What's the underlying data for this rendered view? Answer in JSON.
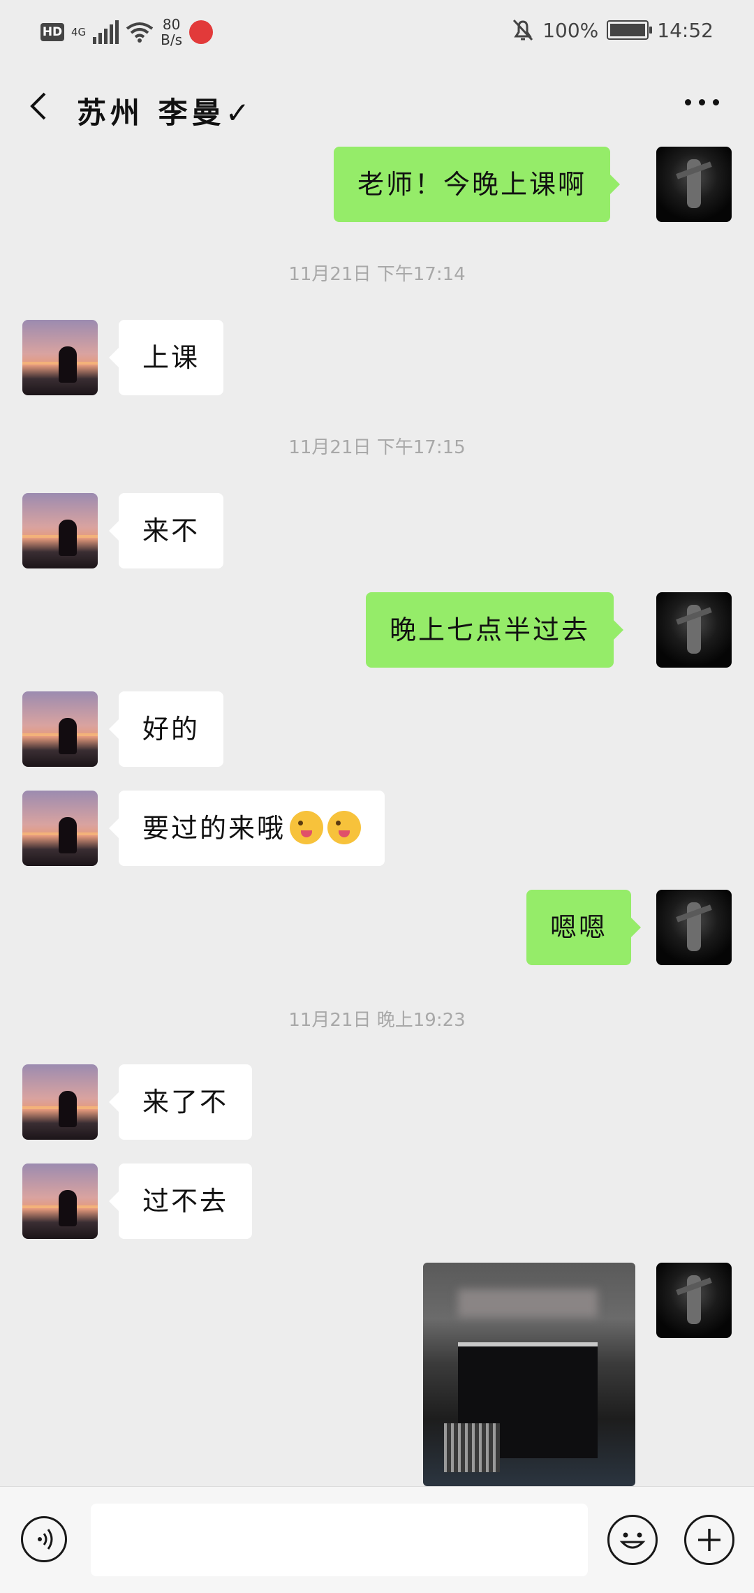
{
  "status_bar": {
    "hd": "HD",
    "network": "4G",
    "speed_value": "80",
    "speed_unit": "B/s",
    "battery": "100%",
    "time": "14:52"
  },
  "header": {
    "title": "苏州 李曼✓"
  },
  "messages": [
    {
      "type": "out",
      "text": "老师！今晚上课啊"
    },
    {
      "type": "time",
      "text": "11月21日 下午17:14"
    },
    {
      "type": "in",
      "text": "上课"
    },
    {
      "type": "time",
      "text": "11月21日 下午17:15"
    },
    {
      "type": "in",
      "text": "来不"
    },
    {
      "type": "out",
      "text": "晚上七点半过去"
    },
    {
      "type": "in",
      "text": "好的"
    },
    {
      "type": "in",
      "text": "要过的来哦"
    },
    {
      "type": "out",
      "text": "嗯嗯"
    },
    {
      "type": "time",
      "text": "11月21日 晚上19:23"
    },
    {
      "type": "in",
      "text": "来了不"
    },
    {
      "type": "in",
      "text": "过不去"
    },
    {
      "type": "out-image",
      "text": ""
    }
  ],
  "colors": {
    "background": "#ededed",
    "bubble_out": "#95ec69",
    "bubble_in": "#ffffff",
    "timestamp": "#a8a8a8"
  },
  "icons": {
    "back": "chevron-left-icon",
    "more": "more-horizontal-icon",
    "voice": "voice-icon",
    "emoji": "smiley-icon",
    "plus": "plus-icon",
    "mute": "bell-off-icon"
  },
  "input": {
    "value": "",
    "placeholder": ""
  }
}
